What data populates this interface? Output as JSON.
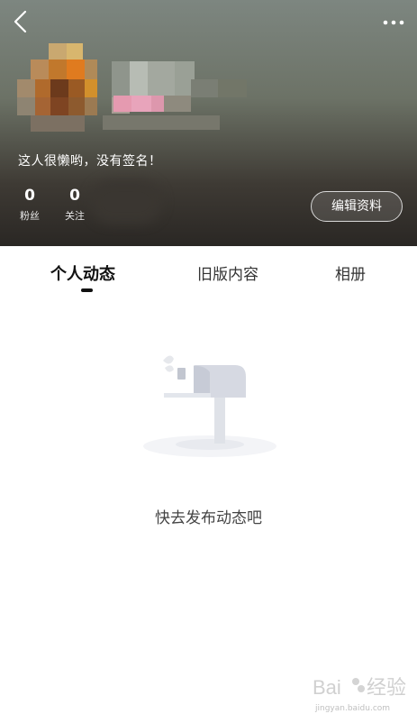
{
  "header": {
    "signature": "这人很懒哟，没有签名！",
    "stats": [
      {
        "value": "0",
        "label": "粉丝"
      },
      {
        "value": "0",
        "label": "关注"
      }
    ],
    "edit_profile_label": "编辑资料",
    "icons": {
      "back": "chevron-left-icon",
      "more": "more-dots-icon"
    }
  },
  "tabs": [
    {
      "label": "个人动态",
      "active": true
    },
    {
      "label": "旧版内容",
      "active": false
    },
    {
      "label": "相册",
      "active": false
    }
  ],
  "empty_state": {
    "message": "快去发布动态吧",
    "icon": "mailbox-icon"
  },
  "watermark": {
    "brand": "Baidu 经验",
    "url": "jingyan.baidu.com"
  },
  "colors": {
    "header_top": "#7d8680",
    "header_bottom": "#2a2724",
    "text_dark": "#111111",
    "text_muted": "#444444"
  }
}
